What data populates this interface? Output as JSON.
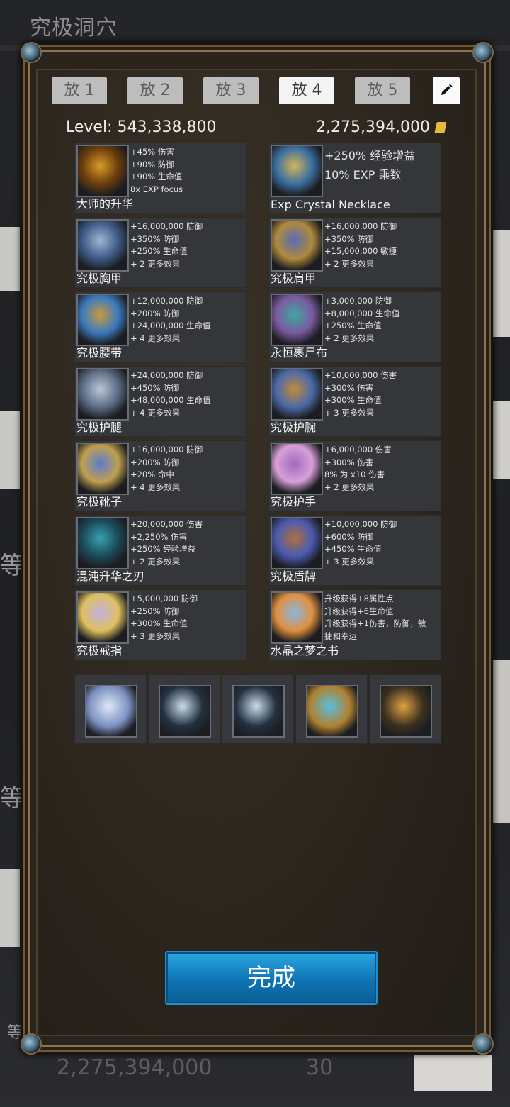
{
  "background": {
    "title": "究极洞穴",
    "side_chars": [
      "等",
      "等",
      "等"
    ],
    "footer_gold": "2,275,394,000",
    "footer_count": "30"
  },
  "tabs": [
    {
      "label": "放 1",
      "active": false
    },
    {
      "label": "放 2",
      "active": false
    },
    {
      "label": "放 3",
      "active": false
    },
    {
      "label": "放 4",
      "active": true
    },
    {
      "label": "放 5",
      "active": false
    }
  ],
  "edit_icon": "pencil-icon",
  "level_label": "Level:",
  "level_value": "543,338,800",
  "gold_value": "2,275,394,000",
  "gear": [
    {
      "name": "大师的升华",
      "icon": "circlet-icon",
      "big": false,
      "stats": [
        "+45% 伤害",
        "+90% 防御",
        "+90% 生命值",
        "8x EXP focus"
      ]
    },
    {
      "name": "Exp Crystal Necklace",
      "icon": "necklace-icon",
      "big": true,
      "stats": [
        "+250% 经验增益",
        "10% EXP 乘数"
      ]
    },
    {
      "name": "究极胸甲",
      "icon": "chestplate-icon",
      "big": false,
      "stats": [
        "+16,000,000 防御",
        "+350% 防御",
        "+250% 生命值",
        "+ 2 更多效果"
      ]
    },
    {
      "name": "究极肩甲",
      "icon": "shoulder-armor-icon",
      "big": false,
      "stats": [
        "+16,000,000 防御",
        "+350% 防御",
        "+15,000,000 敏捷",
        "+ 2 更多效果"
      ]
    },
    {
      "name": "究极腰带",
      "icon": "belt-icon",
      "big": false,
      "stats": [
        "+12,000,000 防御",
        "+200% 防御",
        "+24,000,000 生命值",
        "+ 4 更多效果"
      ]
    },
    {
      "name": "永恒裹尸布",
      "icon": "cloak-icon",
      "big": false,
      "stats": [
        "+3,000,000 防御",
        "+8,000,000 生命值",
        "+250% 生命值",
        "+ 2 更多效果"
      ]
    },
    {
      "name": "究极护腿",
      "icon": "leggings-icon",
      "big": false,
      "stats": [
        "+24,000,000 防御",
        "+450% 防御",
        "+48,000,000 生命值",
        "+ 4 更多效果"
      ]
    },
    {
      "name": "究极护腕",
      "icon": "bracer-icon",
      "big": false,
      "stats": [
        "+10,000,000 伤害",
        "+300% 伤害",
        "+300% 生命值",
        "+ 3 更多效果"
      ]
    },
    {
      "name": "究极靴子",
      "icon": "boots-icon",
      "big": false,
      "stats": [
        "+16,000,000 防御",
        "+200% 防御",
        "+20% 命中",
        "+ 4 更多效果"
      ]
    },
    {
      "name": "究极护手",
      "icon": "gauntlets-icon",
      "big": false,
      "stats": [
        "+6,000,000 伤害",
        "+300% 伤害",
        "8% 为 x10 伤害",
        "+ 2 更多效果"
      ]
    },
    {
      "name": "混沌升华之刃",
      "icon": "sword-icon",
      "big": false,
      "stats": [
        "+20,000,000 伤害",
        "+2,250% 伤害",
        "+250% 经验增益",
        "+ 2 更多效果"
      ]
    },
    {
      "name": "究极盾牌",
      "icon": "shield-icon",
      "big": false,
      "stats": [
        "+10,000,000 防御",
        "+600% 防御",
        "+450% 生命值",
        "+ 3 更多效果"
      ]
    },
    {
      "name": "究极戒指",
      "icon": "ring-icon",
      "big": false,
      "stats": [
        "+5,000,000 防御",
        "+250% 防御",
        "+300% 生命值",
        "+ 3 更多效果"
      ]
    },
    {
      "name": "水晶之梦之书",
      "icon": "book-icon",
      "big": false,
      "stats": [
        "升级获得+8属性点",
        "升级获得+6生命值",
        "升级获得+1伤害，防御，敏",
        "捷和幸运"
      ]
    }
  ],
  "consumables": [
    "crystal-icon",
    "orb-icon",
    "orb-icon",
    "amulet-icon",
    "earrings-icon"
  ],
  "done_label": "完成",
  "colors": {
    "accent": "#1c8fd0",
    "panel": "#34363a",
    "gold": "#e7bb3a"
  }
}
